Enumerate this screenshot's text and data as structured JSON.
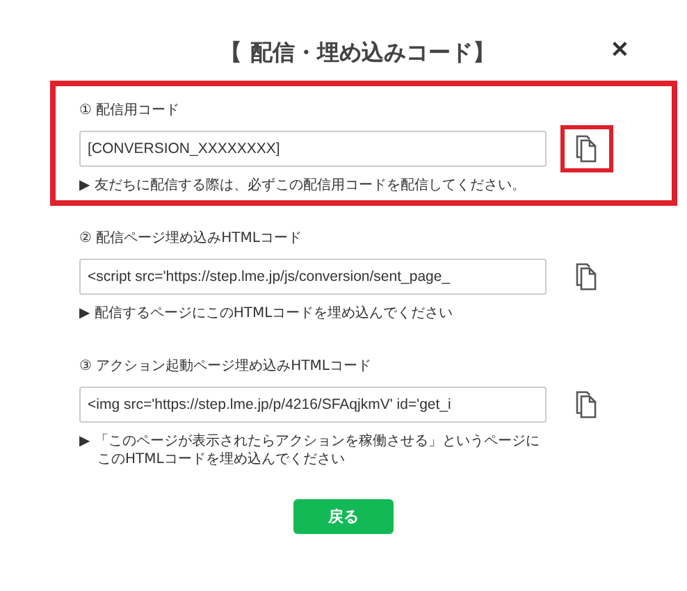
{
  "title": "【 配信・埋め込みコード】",
  "close": "✕",
  "sections": [
    {
      "label": "① 配信用コード",
      "value": "[CONVERSION_XXXXXXXX]",
      "notes": [
        "▶ 友だちに配信する際は、必ずこの配信用コードを配信してください。"
      ],
      "highlighted": true,
      "copy_highlighted": true
    },
    {
      "label": "② 配信ページ埋め込みHTMLコード",
      "value": "<script src='https://step.lme.jp/js/conversion/sent_page_",
      "notes": [
        "▶ 配信するページにこのHTMLコードを埋め込んでください"
      ],
      "highlighted": false,
      "copy_highlighted": false
    },
    {
      "label": "③ アクション起動ページ埋め込みHTMLコード",
      "value": "<img src='https://step.lme.jp/p/4216/SFAqjkmV' id='get_i",
      "notes": [
        "▶ 「このページが表示されたらアクションを稼働させる」というページに",
        "このHTMLコードを埋め込んでください"
      ],
      "highlighted": false,
      "copy_highlighted": false
    }
  ],
  "back_button": "戻る"
}
